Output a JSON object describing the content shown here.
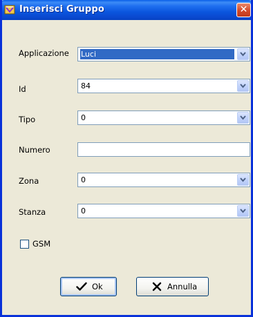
{
  "window": {
    "title": "Inserisci Gruppo",
    "close_glyph": "✕"
  },
  "form": {
    "applicazione": {
      "label": "Applicazione",
      "value": "Luci"
    },
    "id": {
      "label": "Id",
      "value": "84"
    },
    "tipo": {
      "label": "Tipo",
      "value": "0"
    },
    "numero": {
      "label": "Numero",
      "value": ""
    },
    "zona": {
      "label": "Zona",
      "value": "0"
    },
    "stanza": {
      "label": "Stanza",
      "value": "0"
    },
    "gsm": {
      "label": "GSM",
      "checked": false
    }
  },
  "buttons": {
    "ok_label": "Ok",
    "cancel_label": "Annulla"
  },
  "icons": {
    "title": "app-icon",
    "close": "close-icon",
    "dropdown": "chevron-down-icon",
    "ok": "check-icon",
    "cancel": "x-icon"
  },
  "colors": {
    "titlebar": "#0a55dd",
    "frame": "#0831d9",
    "dialog_bg": "#ece9d8",
    "selection": "#316ac5",
    "close_button": "#d2492a"
  }
}
